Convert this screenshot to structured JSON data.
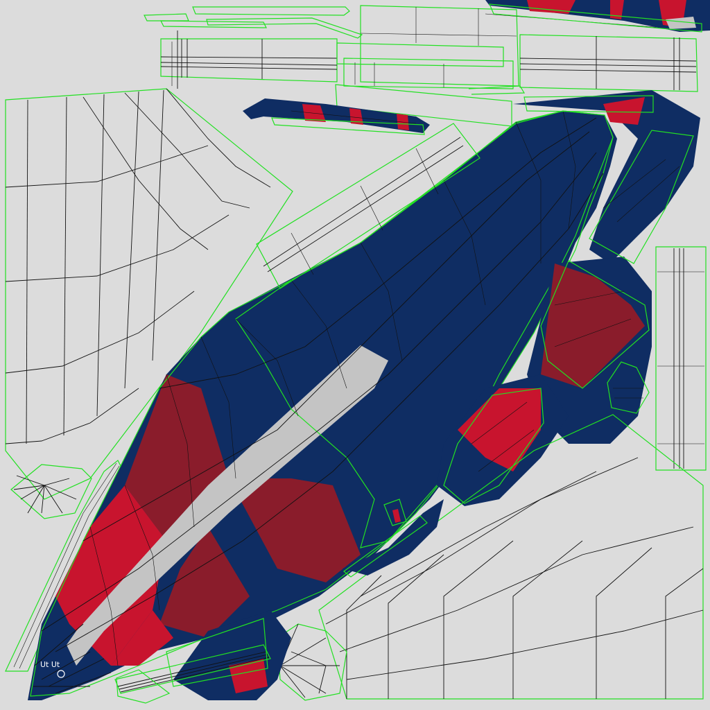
{
  "texture": {
    "colors": {
      "background": "#dcdcdc",
      "navy": "#0f2d63",
      "dark_red": "#8a1c2b",
      "red": "#c8142e",
      "highlight": "#c4c4c4",
      "seam": "#22e022",
      "wireframe": "#111111"
    },
    "decal_text": "Ut Ut"
  }
}
